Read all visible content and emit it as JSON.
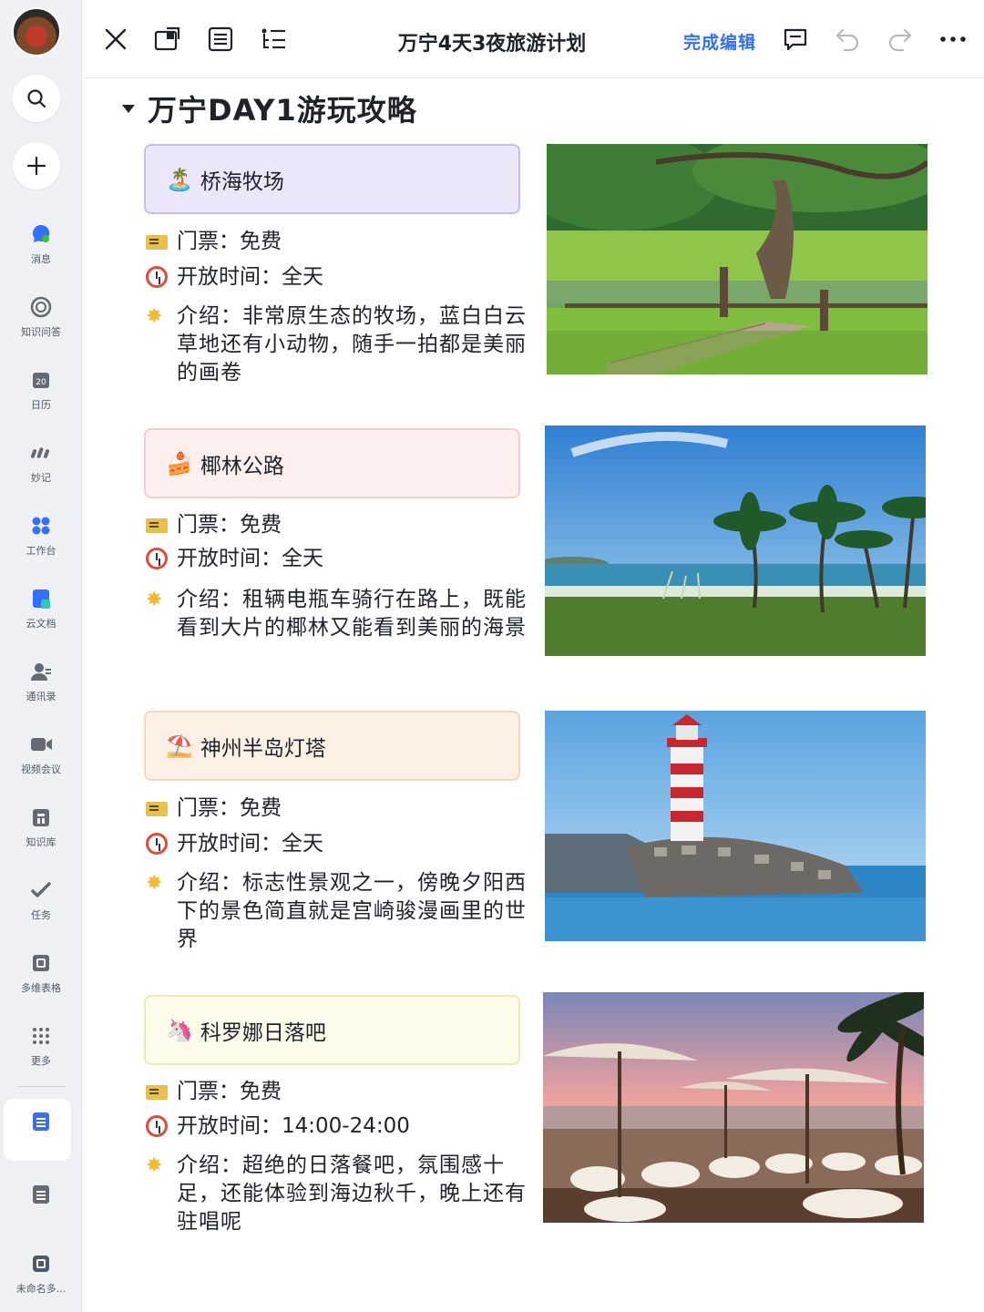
{
  "rail": {
    "items": [
      {
        "label": "消息",
        "icon": "message-icon"
      },
      {
        "label": "知识问答",
        "icon": "qa-icon"
      },
      {
        "label": "日历",
        "icon": "calendar-icon"
      },
      {
        "label": "妙记",
        "icon": "minutes-icon"
      },
      {
        "label": "工作台",
        "icon": "workspace-icon"
      },
      {
        "label": "云文档",
        "icon": "cloud-doc-icon"
      },
      {
        "label": "通讯录",
        "icon": "contacts-icon"
      },
      {
        "label": "视频会议",
        "icon": "video-meeting-icon"
      },
      {
        "label": "知识库",
        "icon": "wiki-icon"
      },
      {
        "label": "任务",
        "icon": "task-icon"
      },
      {
        "label": "多维表格",
        "icon": "base-icon"
      },
      {
        "label": "更多",
        "icon": "more-dots-icon"
      }
    ],
    "bottom_label": "未命名多..."
  },
  "toolbar": {
    "title": "万宁4天3夜旅游计划",
    "finish_label": "完成编辑"
  },
  "heading": "万宁DAY1游玩攻略",
  "spots": [
    {
      "name": "桥海牧场",
      "emoji": "🏝️",
      "ticket": "门票：免费",
      "hours": "开放时间：全天",
      "intro": "介绍：非常原生态的牧场，蓝白白云草地还有小动物，随手一拍都是美丽的画卷",
      "card_color": "#ece6fb",
      "card_border": "#c9bdf0"
    },
    {
      "name": "椰林公路",
      "emoji": "🍰",
      "ticket": "门票：免费",
      "hours": "开放时间：全天",
      "intro": "介绍：租辆电瓶车骑行在路上，既能看到大片的椰林又能看到美丽的海景",
      "card_color": "#fcefee",
      "card_border": "#f1cfcc"
    },
    {
      "name": "神州半岛灯塔",
      "emoji": "⛱️",
      "ticket": "门票：免费",
      "hours": "开放时间：全天",
      "intro": "介绍：标志性景观之一，傍晚夕阳西下的景色简直就是宫崎骏漫画里的世界",
      "card_color": "#fdf1e6",
      "card_border": "#f3d9bd"
    },
    {
      "name": "科罗娜日落吧",
      "emoji": "🦄",
      "ticket": "门票：免费",
      "hours": "开放时间：14:00-24:00",
      "intro": "介绍：超绝的日落餐吧，氛围感十足，还能体验到海边秋千，晚上还有驻唱呢",
      "card_color": "#fdfbea",
      "card_border": "#efe8b8"
    }
  ]
}
